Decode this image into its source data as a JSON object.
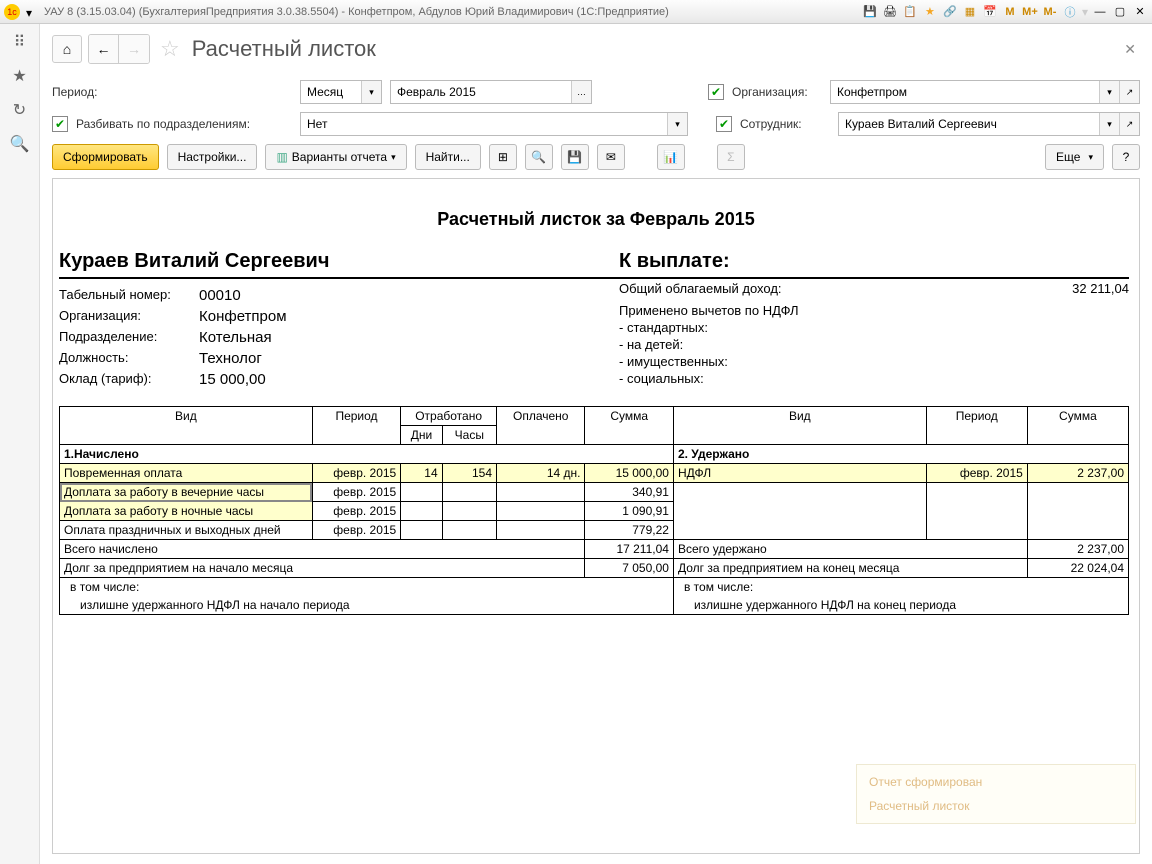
{
  "window": {
    "title": "УАУ 8 (3.15.03.04) (БухгалтерияПредприятия 3.0.38.5504) - Конфетпром, Абдулов Юрий Владимирович  (1С:Предприятие)",
    "m": "M",
    "mplus": "M+",
    "mminus": "M-"
  },
  "page": {
    "title": "Расчетный листок"
  },
  "filters": {
    "period_label": "Период:",
    "period_type": "Месяц",
    "period_value": "Февраль 2015",
    "split_label": "Разбивать по подразделениям:",
    "split_value": "Нет",
    "org_label": "Организация:",
    "org_value": "Конфетпром",
    "emp_label": "Сотрудник:",
    "emp_value": "Кураев Виталий Сергеевич"
  },
  "toolbar": {
    "generate": "Сформировать",
    "settings": "Настройки...",
    "variants": "Варианты отчета",
    "find": "Найти...",
    "more": "Еще",
    "help": "?"
  },
  "report": {
    "title": "Расчетный листок за Февраль 2015",
    "employee": "Кураев Виталий Сергеевич",
    "pay_title": "К выплате:",
    "fields": {
      "tabno_l": "Табельный номер:",
      "tabno_v": "00010",
      "org_l": "Организация:",
      "org_v": "Конфетпром",
      "dept_l": "Подразделение:",
      "dept_v": "Котельная",
      "pos_l": "Должность:",
      "pos_v": "Технолог",
      "salary_l": "Оклад (тариф):",
      "salary_v": "15 000,00"
    },
    "income": {
      "total_l": "Общий облагаемый доход:",
      "total_v": "32 211,04",
      "deductions_l": "Применено вычетов по НДФЛ",
      "d1": "- стандартных:",
      "d2": "- на детей:",
      "d3": "- имущественных:",
      "d4": "- социальных:"
    },
    "headers": {
      "type": "Вид",
      "period": "Период",
      "worked": "Отработано",
      "days": "Дни",
      "hours": "Часы",
      "paid": "Оплачено",
      "sum": "Сумма",
      "accrued": "1.Начислено",
      "withheld": "2. Удержано",
      "total_accrued": "Всего начислено",
      "total_withheld": "Всего удержано",
      "debt_start": "Долг за предприятием на начало месяца",
      "debt_end": "Долг за предприятием на конец месяца",
      "incl": "в том числе:",
      "ndfl_start": "излишне удержанного НДФЛ на начало периода",
      "ndfl_end": "излишне удержанного НДФЛ на конец периода"
    },
    "rows": {
      "r1": {
        "name": "Повременная оплата",
        "period": "февр. 2015",
        "days": "14",
        "hours": "154",
        "paid": "14 дн.",
        "sum": "15 000,00"
      },
      "r2": {
        "name": "Доплата за работу в вечерние часы",
        "period": "февр. 2015",
        "sum": "340,91"
      },
      "r3": {
        "name": "Доплата за работу в ночные часы",
        "period": "февр. 2015",
        "sum": "1 090,91"
      },
      "r4": {
        "name": "Оплата праздничных и выходных дней",
        "period": "февр. 2015",
        "sum": "779,22"
      },
      "ndfl": {
        "name": "НДФЛ",
        "period": "февр. 2015",
        "sum": "2 237,00"
      },
      "total_accrued": "17 211,04",
      "total_withheld": "2 237,00",
      "debt_start": "7 050,00",
      "debt_end": "22 024,04"
    }
  },
  "notify": {
    "line1": "Отчет сформирован",
    "line2": "Расчетный листок"
  }
}
